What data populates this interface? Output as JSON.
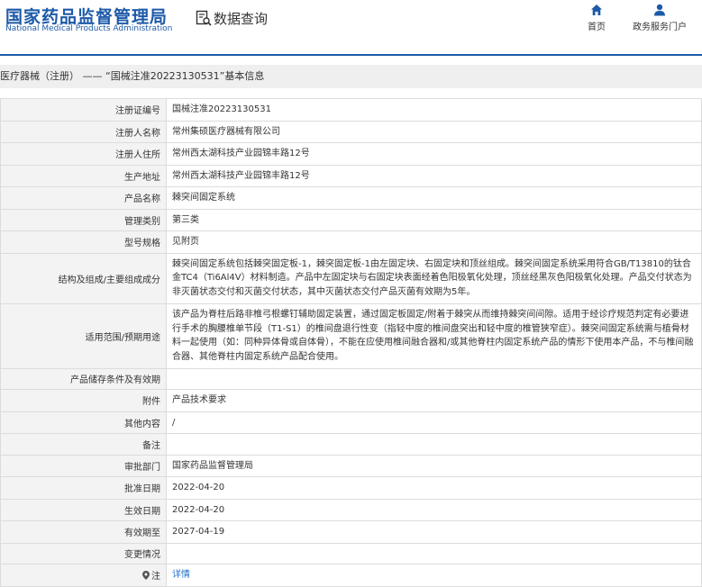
{
  "header": {
    "logo_cn": "国家药品监督管理局",
    "logo_en": "National Medical Products Administration",
    "query_label": "数据查询",
    "nav": [
      {
        "label": "首页",
        "icon": "home-icon"
      },
      {
        "label": "政务服务门户",
        "icon": "user-icon"
      }
    ],
    "brand_color": "#1d5aa8"
  },
  "breadcrumb": "医疗器械（注册） —— “国械注准20223130531”基本信息",
  "rows": [
    {
      "key": "注册证编号",
      "value": "国械注准20223130531"
    },
    {
      "key": "注册人名称",
      "value": "常州集硕医疗器械有限公司"
    },
    {
      "key": "注册人住所",
      "value": "常州西太湖科技产业园锦丰路12号"
    },
    {
      "key": "生产地址",
      "value": "常州西太湖科技产业园锦丰路12号"
    },
    {
      "key": "产品名称",
      "value": "棘突间固定系统"
    },
    {
      "key": "管理类别",
      "value": "第三类"
    },
    {
      "key": "型号规格",
      "value": "见附页"
    },
    {
      "key": "结构及组成/主要组成成分",
      "value": "棘突间固定系统包括棘突固定板-1，棘突固定板-1由左固定块、右固定块和顶丝组成。棘突间固定系统采用符合GB/T13810的钛合金TC4（Ti6Al4V）材料制造。产品中左固定块与右固定块表面经着色阳极氧化处理，顶丝经黑灰色阳极氧化处理。产品交付状态为非灭菌状态交付和灭菌交付状态，其中灭菌状态交付产品灭菌有效期为5年。"
    },
    {
      "key": "适用范围/预期用途",
      "value": "该产品为脊柱后路非椎弓根螺钉辅助固定装置，通过固定板固定/附着于棘突从而维持棘突间间隙。适用于经诊疗规范判定有必要进行手术的胸腰椎单节段（T1-S1）的椎间盘退行性变（指轻中度的椎间盘突出和轻中度的椎管狭窄症）。棘突间固定系统需与植骨材料一起使用（如：同种异体骨或自体骨），不能在应使用椎间融合器和/或其他脊柱内固定系统产品的情形下使用本产品，不与椎间融合器、其他脊柱内固定系统产品配合使用。"
    },
    {
      "key": "产品储存条件及有效期",
      "value": ""
    },
    {
      "key": "附件",
      "value": "产品技术要求"
    },
    {
      "key": "其他内容",
      "value": "/"
    },
    {
      "key": "备注",
      "value": ""
    },
    {
      "key": "审批部门",
      "value": "国家药品监督管理局"
    },
    {
      "key": "批准日期",
      "value": "2022-04-20"
    },
    {
      "key": "生效日期",
      "value": "2022-04-20"
    },
    {
      "key": "有效期至",
      "value": "2027-04-19"
    },
    {
      "key": "变更情况",
      "value": ""
    }
  ],
  "note": {
    "key": "注",
    "link": "详情",
    "icon": "location-pin-icon"
  }
}
